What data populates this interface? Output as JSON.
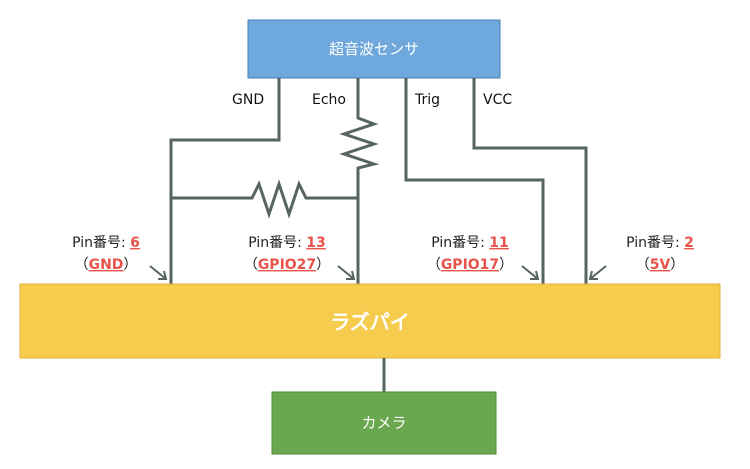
{
  "sensor": {
    "label": "超音波センサ"
  },
  "board": {
    "label": "ラズパイ"
  },
  "camera": {
    "label": "カメラ"
  },
  "wires": {
    "gnd": "GND",
    "echo": "Echo",
    "trig": "Trig",
    "vcc": "VCC"
  },
  "pins": [
    {
      "prefix": "Pin番号: ",
      "number": "6",
      "name": "GND"
    },
    {
      "prefix": "Pin番号: ",
      "number": "13",
      "name": "GPIO27"
    },
    {
      "prefix": "Pin番号: ",
      "number": "11",
      "name": "GPIO17"
    },
    {
      "prefix": "Pin番号: ",
      "number": "2",
      "name": "5V"
    }
  ],
  "paren": {
    "open": "（",
    "close": "）"
  },
  "colors": {
    "sensor": "#6fa8dc",
    "board": "#f6cc4f",
    "camera": "#6aa84f",
    "wire": "#56665e",
    "pin_number": "#e8534a"
  }
}
